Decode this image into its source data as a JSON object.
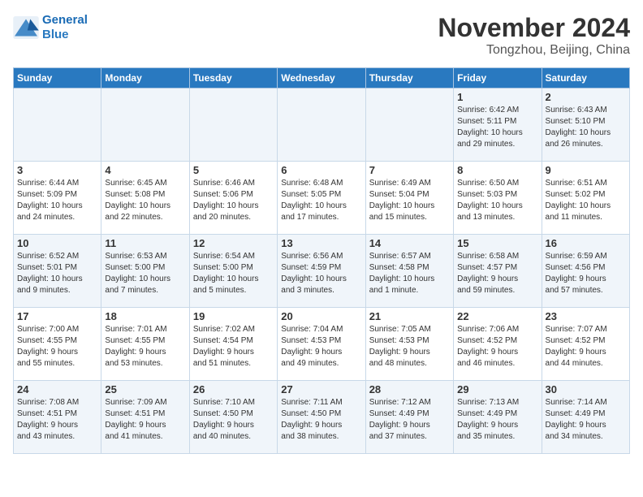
{
  "logo": {
    "line1": "General",
    "line2": "Blue"
  },
  "title": "November 2024",
  "location": "Tongzhou, Beijing, China",
  "weekdays": [
    "Sunday",
    "Monday",
    "Tuesday",
    "Wednesday",
    "Thursday",
    "Friday",
    "Saturday"
  ],
  "weeks": [
    [
      {
        "day": "",
        "info": ""
      },
      {
        "day": "",
        "info": ""
      },
      {
        "day": "",
        "info": ""
      },
      {
        "day": "",
        "info": ""
      },
      {
        "day": "",
        "info": ""
      },
      {
        "day": "1",
        "info": "Sunrise: 6:42 AM\nSunset: 5:11 PM\nDaylight: 10 hours\nand 29 minutes."
      },
      {
        "day": "2",
        "info": "Sunrise: 6:43 AM\nSunset: 5:10 PM\nDaylight: 10 hours\nand 26 minutes."
      }
    ],
    [
      {
        "day": "3",
        "info": "Sunrise: 6:44 AM\nSunset: 5:09 PM\nDaylight: 10 hours\nand 24 minutes."
      },
      {
        "day": "4",
        "info": "Sunrise: 6:45 AM\nSunset: 5:08 PM\nDaylight: 10 hours\nand 22 minutes."
      },
      {
        "day": "5",
        "info": "Sunrise: 6:46 AM\nSunset: 5:06 PM\nDaylight: 10 hours\nand 20 minutes."
      },
      {
        "day": "6",
        "info": "Sunrise: 6:48 AM\nSunset: 5:05 PM\nDaylight: 10 hours\nand 17 minutes."
      },
      {
        "day": "7",
        "info": "Sunrise: 6:49 AM\nSunset: 5:04 PM\nDaylight: 10 hours\nand 15 minutes."
      },
      {
        "day": "8",
        "info": "Sunrise: 6:50 AM\nSunset: 5:03 PM\nDaylight: 10 hours\nand 13 minutes."
      },
      {
        "day": "9",
        "info": "Sunrise: 6:51 AM\nSunset: 5:02 PM\nDaylight: 10 hours\nand 11 minutes."
      }
    ],
    [
      {
        "day": "10",
        "info": "Sunrise: 6:52 AM\nSunset: 5:01 PM\nDaylight: 10 hours\nand 9 minutes."
      },
      {
        "day": "11",
        "info": "Sunrise: 6:53 AM\nSunset: 5:00 PM\nDaylight: 10 hours\nand 7 minutes."
      },
      {
        "day": "12",
        "info": "Sunrise: 6:54 AM\nSunset: 5:00 PM\nDaylight: 10 hours\nand 5 minutes."
      },
      {
        "day": "13",
        "info": "Sunrise: 6:56 AM\nSunset: 4:59 PM\nDaylight: 10 hours\nand 3 minutes."
      },
      {
        "day": "14",
        "info": "Sunrise: 6:57 AM\nSunset: 4:58 PM\nDaylight: 10 hours\nand 1 minute."
      },
      {
        "day": "15",
        "info": "Sunrise: 6:58 AM\nSunset: 4:57 PM\nDaylight: 9 hours\nand 59 minutes."
      },
      {
        "day": "16",
        "info": "Sunrise: 6:59 AM\nSunset: 4:56 PM\nDaylight: 9 hours\nand 57 minutes."
      }
    ],
    [
      {
        "day": "17",
        "info": "Sunrise: 7:00 AM\nSunset: 4:55 PM\nDaylight: 9 hours\nand 55 minutes."
      },
      {
        "day": "18",
        "info": "Sunrise: 7:01 AM\nSunset: 4:55 PM\nDaylight: 9 hours\nand 53 minutes."
      },
      {
        "day": "19",
        "info": "Sunrise: 7:02 AM\nSunset: 4:54 PM\nDaylight: 9 hours\nand 51 minutes."
      },
      {
        "day": "20",
        "info": "Sunrise: 7:04 AM\nSunset: 4:53 PM\nDaylight: 9 hours\nand 49 minutes."
      },
      {
        "day": "21",
        "info": "Sunrise: 7:05 AM\nSunset: 4:53 PM\nDaylight: 9 hours\nand 48 minutes."
      },
      {
        "day": "22",
        "info": "Sunrise: 7:06 AM\nSunset: 4:52 PM\nDaylight: 9 hours\nand 46 minutes."
      },
      {
        "day": "23",
        "info": "Sunrise: 7:07 AM\nSunset: 4:52 PM\nDaylight: 9 hours\nand 44 minutes."
      }
    ],
    [
      {
        "day": "24",
        "info": "Sunrise: 7:08 AM\nSunset: 4:51 PM\nDaylight: 9 hours\nand 43 minutes."
      },
      {
        "day": "25",
        "info": "Sunrise: 7:09 AM\nSunset: 4:51 PM\nDaylight: 9 hours\nand 41 minutes."
      },
      {
        "day": "26",
        "info": "Sunrise: 7:10 AM\nSunset: 4:50 PM\nDaylight: 9 hours\nand 40 minutes."
      },
      {
        "day": "27",
        "info": "Sunrise: 7:11 AM\nSunset: 4:50 PM\nDaylight: 9 hours\nand 38 minutes."
      },
      {
        "day": "28",
        "info": "Sunrise: 7:12 AM\nSunset: 4:49 PM\nDaylight: 9 hours\nand 37 minutes."
      },
      {
        "day": "29",
        "info": "Sunrise: 7:13 AM\nSunset: 4:49 PM\nDaylight: 9 hours\nand 35 minutes."
      },
      {
        "day": "30",
        "info": "Sunrise: 7:14 AM\nSunset: 4:49 PM\nDaylight: 9 hours\nand 34 minutes."
      }
    ]
  ]
}
